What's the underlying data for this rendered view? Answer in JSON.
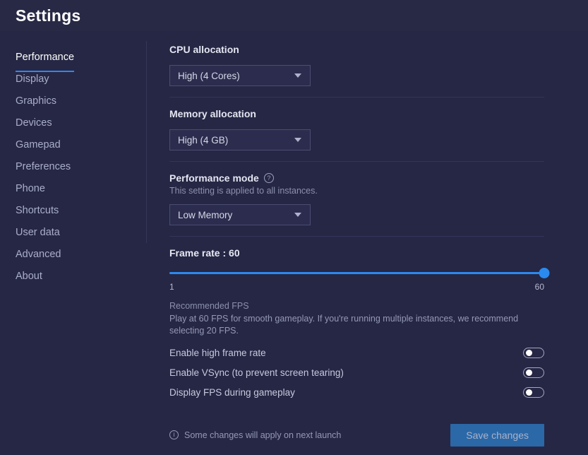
{
  "header": {
    "title": "Settings"
  },
  "sidebar": {
    "items": [
      {
        "label": "Performance",
        "active": true
      },
      {
        "label": "Display",
        "active": false
      },
      {
        "label": "Graphics",
        "active": false
      },
      {
        "label": "Devices",
        "active": false
      },
      {
        "label": "Gamepad",
        "active": false
      },
      {
        "label": "Preferences",
        "active": false
      },
      {
        "label": "Phone",
        "active": false
      },
      {
        "label": "Shortcuts",
        "active": false
      },
      {
        "label": "User data",
        "active": false
      },
      {
        "label": "Advanced",
        "active": false
      },
      {
        "label": "About",
        "active": false
      }
    ]
  },
  "main": {
    "cpu": {
      "label": "CPU allocation",
      "value": "High (4 Cores)"
    },
    "memory": {
      "label": "Memory allocation",
      "value": "High (4 GB)"
    },
    "performance_mode": {
      "label": "Performance mode",
      "help_icon": "question-mark-circle-icon",
      "description": "This setting is applied to all instances.",
      "value": "Low Memory"
    },
    "frame_rate": {
      "title": "Frame rate : 60",
      "value": 60,
      "min": 1,
      "max": 60,
      "min_label": "1",
      "max_label": "60",
      "percent": 100,
      "recommended_title": "Recommended FPS",
      "recommended_body": "Play at 60 FPS for smooth gameplay. If you're running multiple instances, we recommend selecting 20 FPS."
    },
    "toggles": [
      {
        "label": "Enable high frame rate",
        "on": false
      },
      {
        "label": "Enable VSync (to prevent screen tearing)",
        "on": false
      },
      {
        "label": "Display FPS during gameplay",
        "on": false
      }
    ],
    "footer": {
      "info_icon": "info-circle-icon",
      "note": "Some changes will apply on next launch",
      "save_label": "Save changes"
    }
  },
  "colors": {
    "background": "#262744",
    "header_bg": "#282945",
    "accent": "#2a8af0",
    "save_button_bg": "#2b68a8",
    "divider": "#33345a",
    "text_primary": "#e4e6f2",
    "text_muted": "#9498b6"
  }
}
